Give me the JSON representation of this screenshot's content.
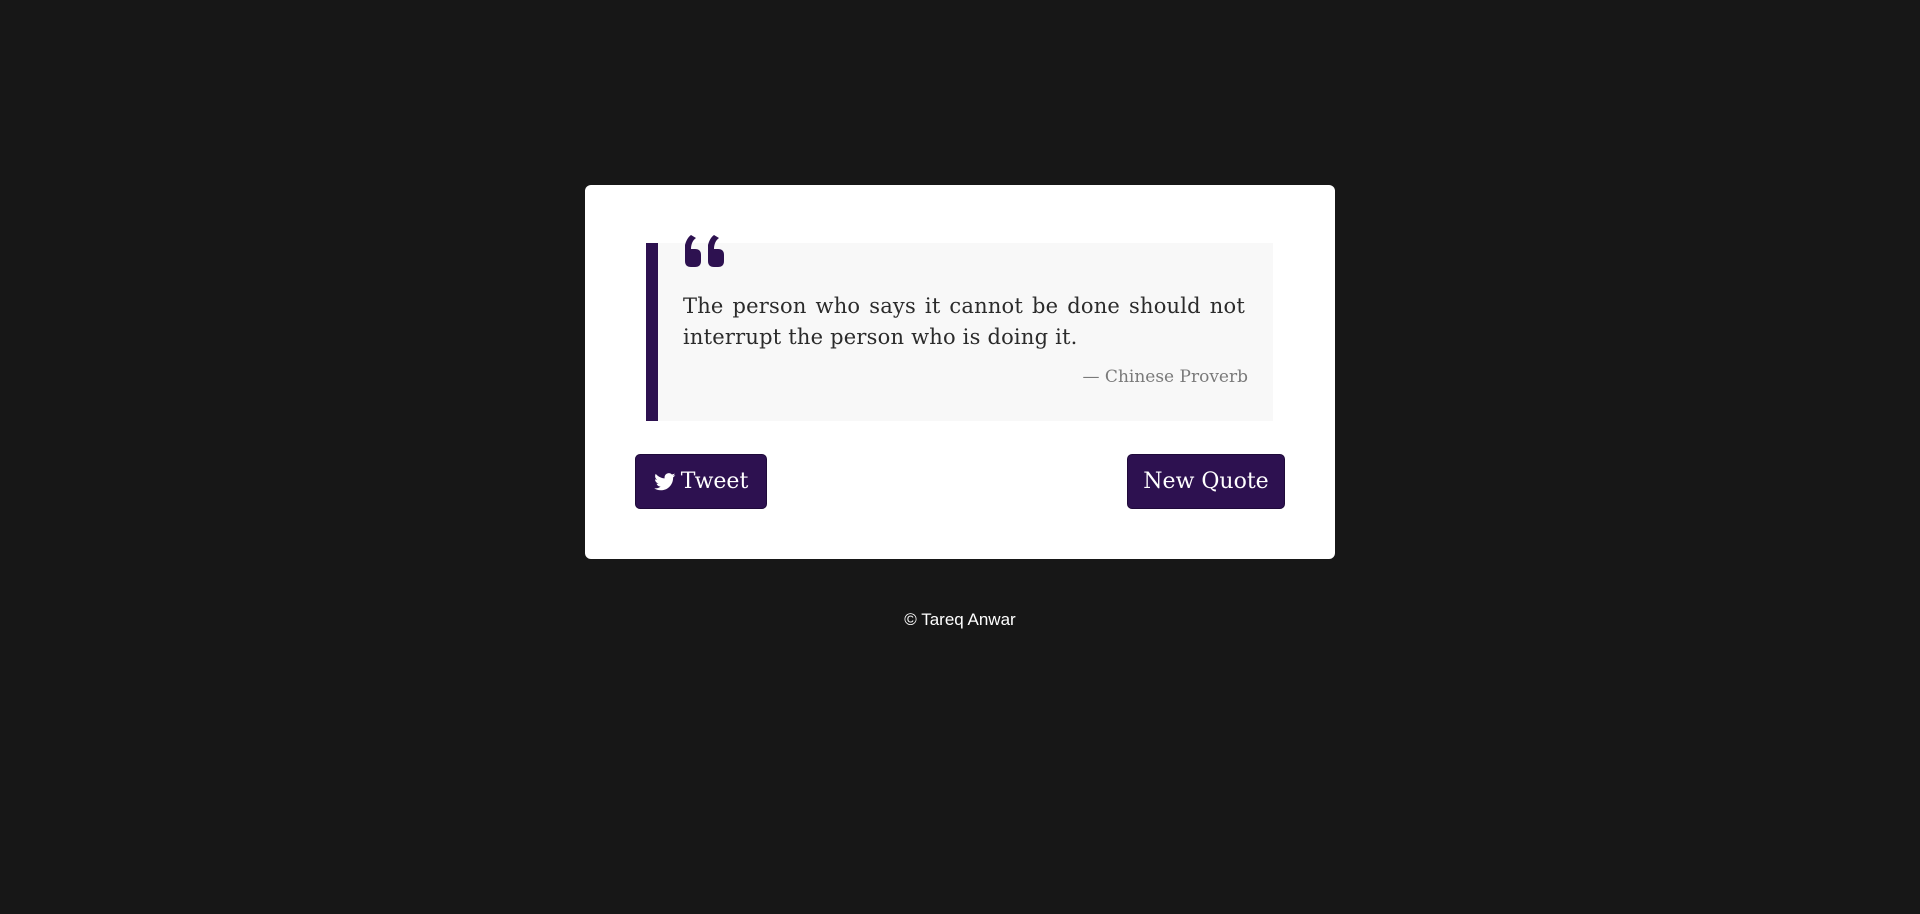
{
  "colors": {
    "page_background": "#171717",
    "card_background": "#ffffff",
    "accent": "#2d1150",
    "quote_box_background": "#f8f8f8",
    "quote_text": "#2b2b2b",
    "author_text": "#7a7a7a",
    "footer_text": "#ffffff"
  },
  "quote": {
    "icon": "quote-left-icon",
    "text": "The person who says it cannot be done should not interrupt the person who is doing it.",
    "author": "— Chinese Proverb"
  },
  "actions": {
    "tweet_icon": "twitter-icon",
    "tweet_label": "Tweet",
    "new_quote_label": "New Quote"
  },
  "footer": {
    "text": "© Tareq Anwar"
  }
}
